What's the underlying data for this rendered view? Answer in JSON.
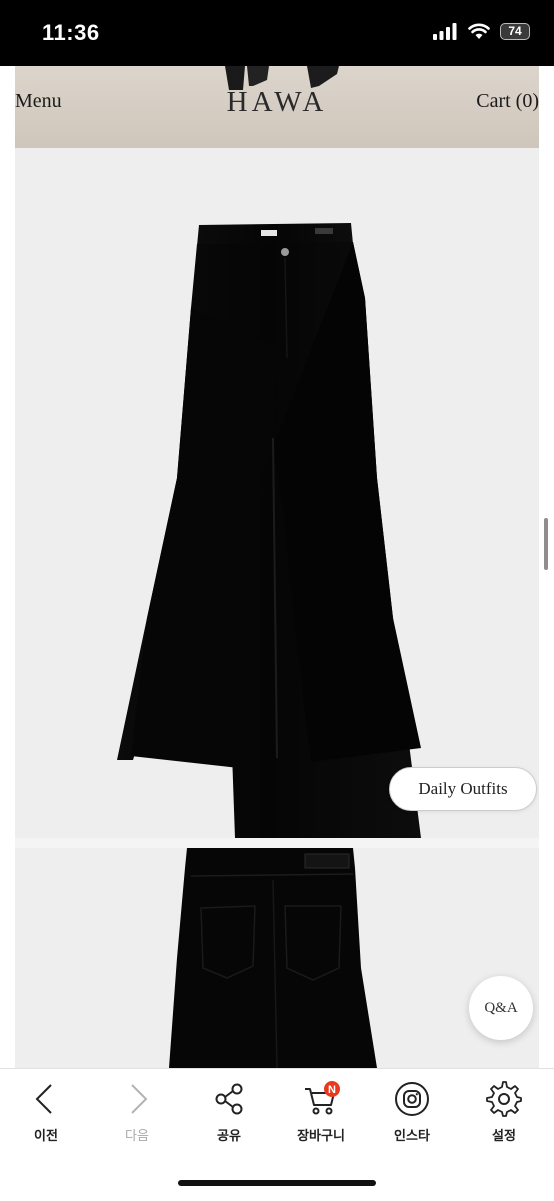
{
  "status_bar": {
    "time": "11:36",
    "battery": "74"
  },
  "header": {
    "menu_label": "Menu",
    "brand": "HAWA",
    "cart_label": "Cart (0)"
  },
  "product": {
    "daily_outfits_label": "Daily Outfits",
    "qa_label": "Q&A"
  },
  "toolbar": {
    "items": [
      {
        "label": "이전",
        "icon": "chevron-left-icon",
        "enabled": true
      },
      {
        "label": "다음",
        "icon": "chevron-right-icon",
        "enabled": false
      },
      {
        "label": "공유",
        "icon": "share-icon",
        "enabled": true
      },
      {
        "label": "장바구니",
        "icon": "cart-icon",
        "enabled": true,
        "badge": "N"
      },
      {
        "label": "인스타",
        "icon": "instagram-icon",
        "enabled": true
      },
      {
        "label": "설정",
        "icon": "gear-icon",
        "enabled": true
      }
    ]
  },
  "colors": {
    "badge": "#e8381e",
    "pants": "#050505",
    "background": "#eeeeee"
  }
}
